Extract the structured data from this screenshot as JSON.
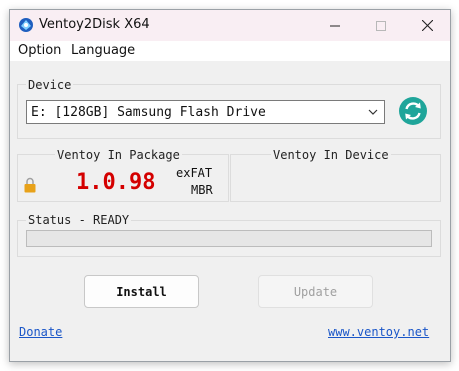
{
  "window": {
    "title": "Ventoy2Disk  X64"
  },
  "menu": {
    "option": "Option",
    "language": "Language"
  },
  "device": {
    "label": "Device",
    "selected": "E: [128GB] Samsung Flash Drive"
  },
  "package": {
    "label": "Ventoy In Package",
    "version": "1.0.98",
    "filesystem": "exFAT",
    "partition_style": "MBR"
  },
  "in_device": {
    "label": "Ventoy In Device"
  },
  "status": {
    "label": "Status - READY"
  },
  "buttons": {
    "install": "Install",
    "update": "Update"
  },
  "links": {
    "donate": "Donate",
    "website": "www.ventoy.net"
  },
  "colors": {
    "version_red": "#d40000",
    "refresh_teal": "#1fa59a",
    "link_blue": "#1a56c8",
    "title_bg": "#f9eef3"
  }
}
